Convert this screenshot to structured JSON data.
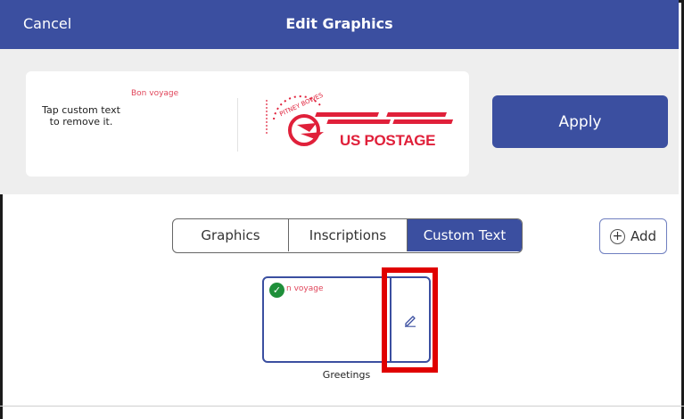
{
  "header": {
    "cancel_label": "Cancel",
    "title": "Edit Graphics"
  },
  "preview": {
    "hint": "Tap custom text to remove it.",
    "custom_text": "Bon voyage",
    "stamp_text": "US POSTAGE",
    "stamp_brand": "PITNEY BOWES"
  },
  "apply_label": "Apply",
  "tabs": [
    {
      "label": "Graphics",
      "selected": false
    },
    {
      "label": "Inscriptions",
      "selected": false
    },
    {
      "label": "Custom Text",
      "selected": true
    }
  ],
  "add_label": "Add",
  "add_icon": "plus-circle-icon",
  "tile": {
    "text": "n voyage",
    "label": "Greetings",
    "check_icon": "check-circle-icon",
    "edit_icon": "pencil-icon"
  },
  "colors": {
    "brand": "#3b4fa0",
    "stamp_red": "#e0203a",
    "highlight": "#e00000",
    "check": "#1f8f3a"
  }
}
